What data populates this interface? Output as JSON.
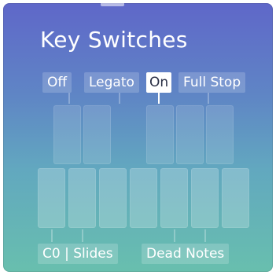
{
  "panel": {
    "title": "Key Switches",
    "top_chips": [
      {
        "label": "Off",
        "active": false
      },
      {
        "label": "Legato",
        "active": false
      },
      {
        "label": "On",
        "active": true
      },
      {
        "label": "Full Stop",
        "active": false
      }
    ],
    "bottom_chips": [
      {
        "label": "C0 | Slides"
      },
      {
        "label": "Dead Notes"
      }
    ]
  },
  "colors": {
    "gradient_top": "#5f67c9",
    "gradient_bottom": "#68bfae",
    "active_chip_bg": "#ffffff",
    "active_chip_text": "#2a2f45"
  }
}
